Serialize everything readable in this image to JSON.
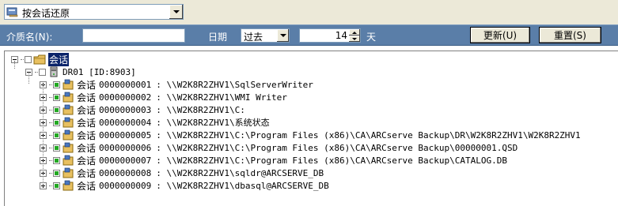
{
  "top": {
    "view_select": "按会话还原"
  },
  "filter": {
    "media_label": "介质名(N):",
    "media_value": "",
    "date_label": "日期",
    "date_option": "过去",
    "days_value": "14",
    "days_unit": "天",
    "update_button": "更新(U)",
    "reset_button": "重置(S)"
  },
  "tree": {
    "root_label": "会话",
    "server_label": "DR01 [ID:8903]",
    "session_prefix": "会话",
    "sessions": [
      {
        "num": "0000000001",
        "path": ": \\\\W2K8R2ZHV1\\SqlServerWriter"
      },
      {
        "num": "0000000002",
        "path": ": \\\\W2K8R2ZHV1\\WMI Writer"
      },
      {
        "num": "0000000003",
        "path": ": \\\\W2K8R2ZHV1\\C:"
      },
      {
        "num": "0000000004",
        "path": ": \\\\W2K8R2ZHV1\\系统状态"
      },
      {
        "num": "0000000005",
        "path": ": \\\\W2K8R2ZHV1\\C:\\Program Files (x86)\\CA\\ARCserve Backup\\DR\\W2K8R2ZHV1\\W2K8R2ZHV1"
      },
      {
        "num": "0000000006",
        "path": ": \\\\W2K8R2ZHV1\\C:\\Program Files (x86)\\CA\\ARCserve Backup\\00000001.QSD"
      },
      {
        "num": "0000000007",
        "path": ": \\\\W2K8R2ZHV1\\C:\\Program Files (x86)\\CA\\ARCserve Backup\\CATALOG.DB"
      },
      {
        "num": "0000000008",
        "path": ": \\\\W2K8R2ZHV1\\sqldr@ARCSERVE_DB"
      },
      {
        "num": "0000000009",
        "path": ": \\\\W2K8R2ZHV1\\dbasql@ARCSERVE_DB"
      }
    ]
  },
  "colors": {
    "filter_bar": "#5a7ea8",
    "selection": "#0a246a",
    "check_green": "#22a822",
    "window_bg": "#ece9d8"
  }
}
